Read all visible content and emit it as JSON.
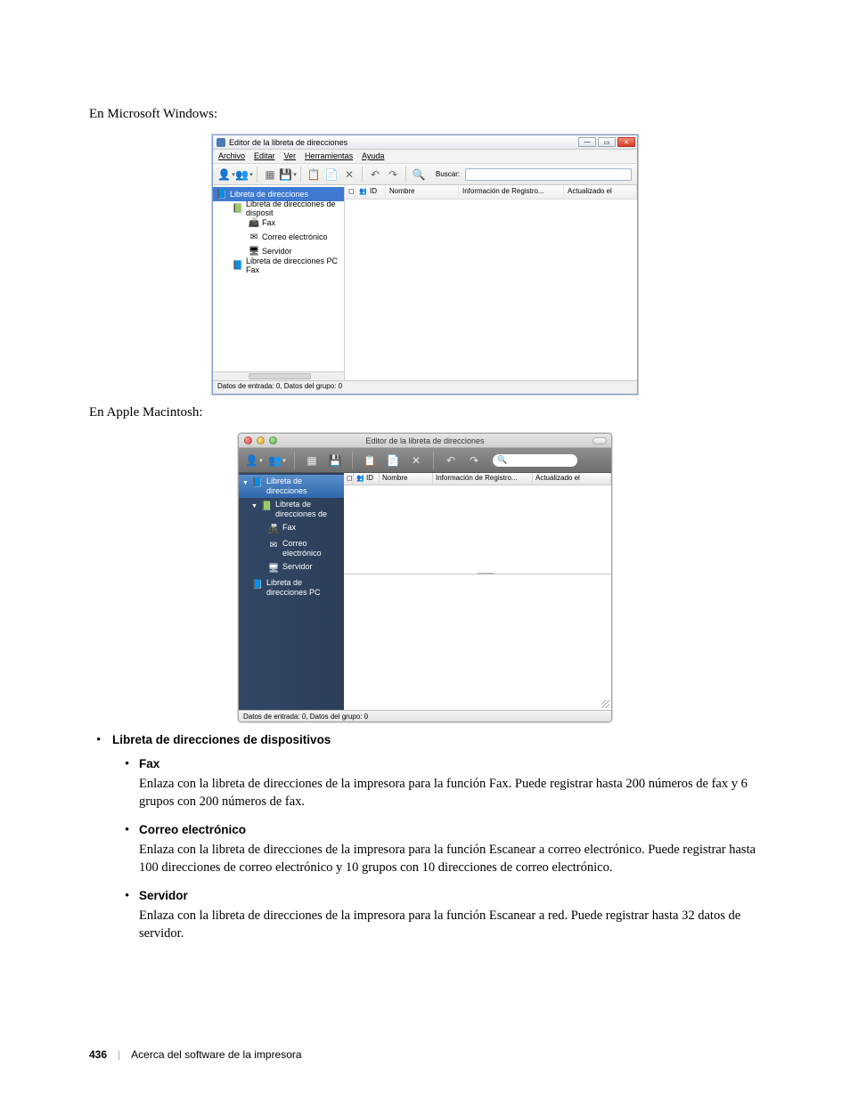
{
  "doc": {
    "intro_win": "En Microsoft Windows:",
    "intro_mac": "En Apple Macintosh:",
    "bullets": {
      "h1": "Libreta de direcciones de dispositivos",
      "fax_h": "Fax",
      "fax_p": "Enlaza con la libreta de direcciones de la impresora para la función Fax. Puede registrar hasta 200 números de fax y 6 grupos con 200 números de fax.",
      "email_h": "Correo electrónico",
      "email_p": "Enlaza con la libreta de direcciones de la impresora para la función Escanear a correo electrónico. Puede registrar hasta 100 direcciones de correo electrónico y 10 grupos con 10 direcciones de correo electrónico.",
      "server_h": "Servidor",
      "server_p": "Enlaza con la libreta de direcciones de la impresora para la función Escanear a red. Puede registrar hasta 32 datos de servidor."
    }
  },
  "footer": {
    "page": "436",
    "section": "Acerca del software de la impresora"
  },
  "win": {
    "title": "Editor de la libreta de direcciones",
    "menu": {
      "archivo": "Archivo",
      "editar": "Editar",
      "ver": "Ver",
      "herr": "Herramientas",
      "ayuda": "Ayuda"
    },
    "search_label": "Buscar:",
    "tree": {
      "root": "Libreta de direcciones",
      "device": "Libreta de direcciones de disposit",
      "fax": "Fax",
      "email": "Correo electrónico",
      "server": "Servidor",
      "pcfax": "Libreta de direcciones PC Fax"
    },
    "cols": {
      "id": "ID",
      "nombre": "Nombre",
      "info": "Información de Registro...",
      "upd": "Actualizado el"
    },
    "status": "Datos de entrada: 0, Datos del grupo: 0"
  },
  "mac": {
    "title": "Editor de la libreta de direcciones",
    "tree": {
      "root": "Libreta de direcciones",
      "device": "Libreta de direcciones de",
      "fax": "Fax",
      "email": "Correo electrónico",
      "server": "Servidor",
      "pcfax": "Libreta de direcciones PC"
    },
    "cols": {
      "id": "ID",
      "nombre": "Nombre",
      "info": "Información de Registro...",
      "upd": "Actualizado el"
    },
    "status": "Datos de entrada: 0, Datos del grupo: 0"
  }
}
